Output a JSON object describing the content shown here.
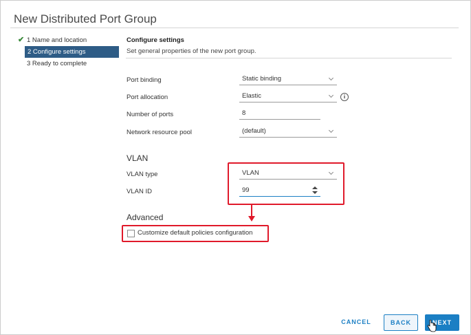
{
  "dialog": {
    "title": "New Distributed Port Group"
  },
  "steps": [
    {
      "label": "1 Name and location",
      "state": "complete"
    },
    {
      "label": "2 Configure settings",
      "state": "active"
    },
    {
      "label": "3 Ready to complete",
      "state": "pending"
    }
  ],
  "configure": {
    "heading": "Configure settings",
    "description": "Set general properties of the new port group."
  },
  "fields": {
    "port_binding": {
      "label": "Port binding",
      "value": "Static binding"
    },
    "port_allocation": {
      "label": "Port allocation",
      "value": "Elastic"
    },
    "number_of_ports": {
      "label": "Number of ports",
      "value": "8"
    },
    "network_resource_pool": {
      "label": "Network resource pool",
      "value": "(default)"
    }
  },
  "vlan": {
    "heading": "VLAN",
    "type_label": "VLAN type",
    "type_value": "VLAN",
    "id_label": "VLAN ID",
    "id_value": "99"
  },
  "advanced": {
    "heading": "Advanced",
    "customize_label": "Customize default policies configuration",
    "customize_checked": false
  },
  "buttons": {
    "cancel": "CANCEL",
    "back": "BACK",
    "next": "NEXT"
  },
  "colors": {
    "accent": "#1b7fc4",
    "active_step": "#2e5c86",
    "highlight": "#e0192a",
    "check": "#3a8a3a"
  },
  "icons": {
    "info": "info-icon",
    "check": "checkmark-icon",
    "chevron": "chevron-down-icon",
    "cursor": "hand-pointer-icon"
  }
}
